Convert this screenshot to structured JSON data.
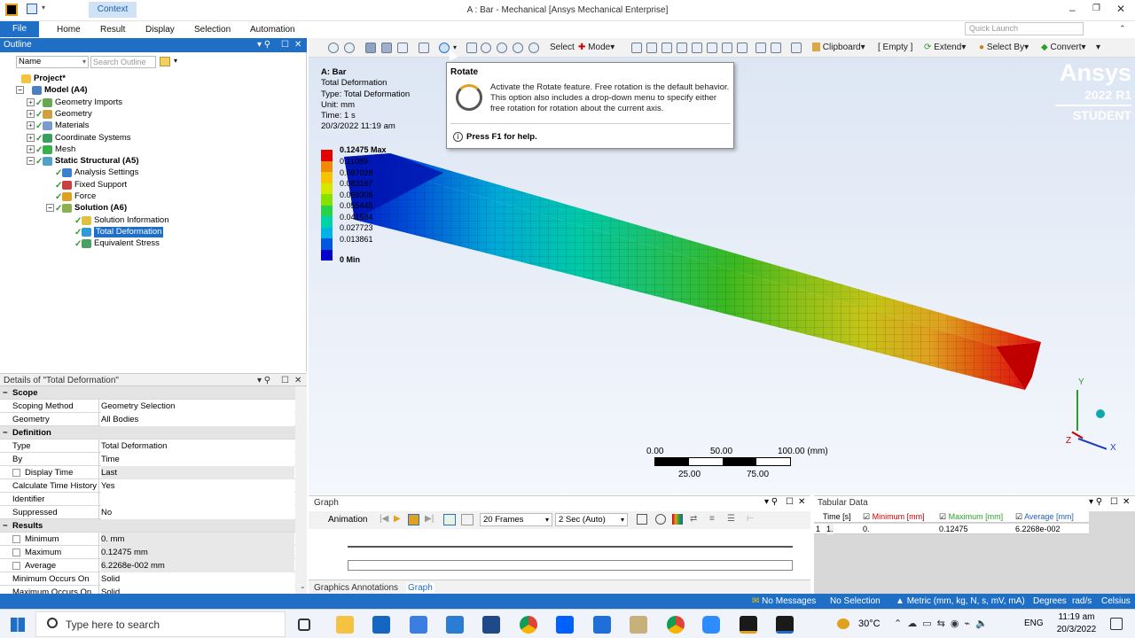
{
  "window": {
    "title": "A : Bar - Mechanical [Ansys Mechanical Enterprise]",
    "context_tab": "Context"
  },
  "ribbon": {
    "tabs": [
      "File",
      "Home",
      "Result",
      "Display",
      "Selection",
      "Automation"
    ],
    "quick_launch_placeholder": "Quick Launch"
  },
  "outline": {
    "header": "Outline",
    "filter_label": "Name",
    "search_placeholder": "Search Outline",
    "tree": [
      {
        "label": "Project*",
        "level": 0,
        "bold": true
      },
      {
        "label": "Model (A4)",
        "level": 1,
        "bold": true
      },
      {
        "label": "Geometry Imports",
        "level": 2
      },
      {
        "label": "Geometry",
        "level": 2
      },
      {
        "label": "Materials",
        "level": 2
      },
      {
        "label": "Coordinate Systems",
        "level": 2
      },
      {
        "label": "Mesh",
        "level": 2
      },
      {
        "label": "Static Structural (A5)",
        "level": 2,
        "bold": true
      },
      {
        "label": "Analysis Settings",
        "level": 3
      },
      {
        "label": "Fixed Support",
        "level": 3
      },
      {
        "label": "Force",
        "level": 3
      },
      {
        "label": "Solution (A6)",
        "level": 3,
        "bold": true
      },
      {
        "label": "Solution Information",
        "level": 4
      },
      {
        "label": "Total Deformation",
        "level": 4,
        "selected": true
      },
      {
        "label": "Equivalent Stress",
        "level": 4
      }
    ]
  },
  "details": {
    "header": "Details of \"Total Deformation\"",
    "rows": [
      {
        "section": "Scope"
      },
      {
        "key": "Scoping Method",
        "value": "Geometry Selection"
      },
      {
        "key": "Geometry",
        "value": "All Bodies"
      },
      {
        "section": "Definition"
      },
      {
        "key": "Type",
        "value": "Total Deformation"
      },
      {
        "key": "By",
        "value": "Time"
      },
      {
        "key": "Display Time",
        "value": "Last",
        "box": true
      },
      {
        "key": "Calculate Time History",
        "value": "Yes"
      },
      {
        "key": "Identifier",
        "value": ""
      },
      {
        "key": "Suppressed",
        "value": "No"
      },
      {
        "section": "Results"
      },
      {
        "key": "Minimum",
        "value": "0. mm",
        "box": true
      },
      {
        "key": "Maximum",
        "value": "0.12475 mm",
        "box": true
      },
      {
        "key": "Average",
        "value": "6.2268e-002 mm",
        "box": true
      },
      {
        "key": "Minimum Occurs On",
        "value": "Solid"
      },
      {
        "key": "Maximum Occurs On",
        "value": "Solid"
      }
    ]
  },
  "toolbar": {
    "select": "Select",
    "mode": "Mode",
    "clipboard": "Clipboard",
    "empty": "[ Empty ]",
    "extend": "Extend",
    "select_by": "Select By",
    "convert": "Convert"
  },
  "result_info": {
    "title": "A: Bar",
    "name": "Total Deformation",
    "type": "Type: Total Deformation",
    "unit": "Unit: mm",
    "time": "Time: 1 s",
    "timestamp": "20/3/2022 11:19 am"
  },
  "legend": {
    "max_label": "0.12475 Max",
    "min_label": "0 Min",
    "values": [
      "0.11089",
      "0.097028",
      "0.083167",
      "0.069306",
      "0.055445",
      "0.041584",
      "0.027723",
      "0.013861"
    ],
    "colors": [
      "#e30000",
      "#f08a00",
      "#f4c400",
      "#d6e800",
      "#86e000",
      "#2ad24a",
      "#00d3a8",
      "#00b2e8",
      "#0057e0",
      "#0000c8"
    ]
  },
  "tooltip": {
    "title": "Rotate",
    "body": "Activate the Rotate feature. Free rotation is the default behavior. This option also includes a drop-down menu to specify either free rotation for rotation about the current axis.",
    "help": "Press F1 for help."
  },
  "branding": {
    "name": "Ansys",
    "version": "2022 R1",
    "edition": "STUDENT"
  },
  "scale_bar": {
    "labels_top": [
      "0.00",
      "50.00",
      "100.00 (mm)"
    ],
    "labels_bottom": [
      "25.00",
      "75.00"
    ]
  },
  "axes": {
    "y": "Y",
    "z": "Z",
    "x": "X"
  },
  "graph_panel": {
    "header": "Graph",
    "animation": "Animation",
    "frames": "20 Frames",
    "duration": "2 Sec (Auto)",
    "tabs": [
      "Graphics Annotations",
      "Graph"
    ]
  },
  "tabular": {
    "header": "Tabular Data",
    "columns": [
      "Time [s]",
      "Minimum [mm]",
      "Maximum [mm]",
      "Average [mm]"
    ],
    "column_colors": [
      "#000000",
      "#cc0000",
      "#2e9c2e",
      "#1f5fb8"
    ],
    "rows": [
      [
        "1",
        "1.",
        "0.",
        "0.12475",
        "6.2268e-002"
      ]
    ]
  },
  "status": {
    "messages": "No Messages",
    "selection": "No Selection",
    "units": "Metric (mm, kg, N, s, mV, mA)",
    "degrees": "Degrees",
    "rads": "rad/s",
    "celsius": "Celsius"
  },
  "taskbar": {
    "search": "Type here to search",
    "temperature": "30°C",
    "language": "ENG",
    "time": "11:19 am",
    "date": "20/3/2022"
  }
}
